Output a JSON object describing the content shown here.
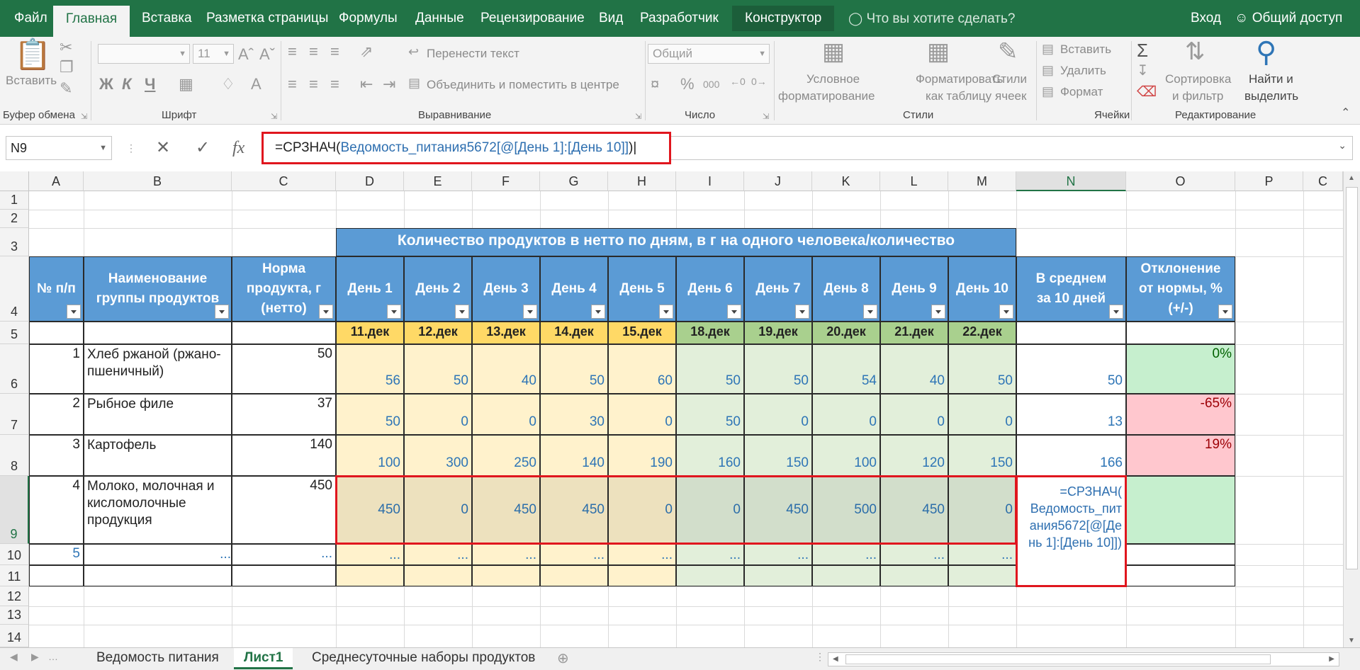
{
  "menu": {
    "tabs": [
      "Файл",
      "Главная",
      "Вставка",
      "Разметка страницы",
      "Формулы",
      "Данные",
      "Рецензирование",
      "Вид",
      "Разработчик",
      "Конструктор"
    ],
    "tell_me": "Что вы хотите сделать?",
    "sign_in": "Вход",
    "share": "Общий доступ"
  },
  "ribbon": {
    "paste": "Вставить",
    "clipboard_group": "Буфер обмена",
    "font_group": "Шрифт",
    "font_size": "11",
    "bold": "Ж",
    "italic": "К",
    "underline": "Ч",
    "wrap_text": "Перенести текст",
    "merge_center": "Объединить и поместить в центре",
    "alignment_group": "Выравнивание",
    "number_format": "Общий",
    "number_group": "Число",
    "conditional_l1": "Условное",
    "conditional_l2": "форматирование",
    "format_table_l1": "Форматировать",
    "format_table_l2": "как таблицу",
    "cell_styles_l1": "Стили",
    "cell_styles_l2": "ячеек",
    "styles_group": "Стили",
    "insert": "Вставить",
    "delete": "Удалить",
    "format": "Формат",
    "cells_group": "Ячейки",
    "sort_l1": "Сортировка",
    "sort_l2": "и фильтр",
    "find_l1": "Найти и",
    "find_l2": "выделить",
    "editing_group": "Редактирование"
  },
  "formula_bar": {
    "name_box": "N9",
    "formula_prefix": "=СРЗНАЧ(",
    "formula_ref": "Ведомость_питания5672[@[День 1]:[День 10]]",
    "formula_suffix": ")"
  },
  "columns": [
    "A",
    "B",
    "C",
    "D",
    "E",
    "F",
    "G",
    "H",
    "I",
    "J",
    "K",
    "L",
    "M",
    "N",
    "O",
    "P",
    "C"
  ],
  "rows": [
    "1",
    "2",
    "3",
    "4",
    "5",
    "6",
    "7",
    "8",
    "9",
    "10",
    "11",
    "12",
    "13",
    "14"
  ],
  "table": {
    "banner": "Количество продуктов в нетто по дням, в г на одного человека/количество",
    "headers": {
      "num": "№ п/п",
      "name_l1": "Наименование",
      "name_l2": "группы продуктов",
      "norm_l1": "Норма",
      "norm_l2": "продукта, г",
      "norm_l3": "(нетто)",
      "days": [
        "День 1",
        "День 2",
        "День 3",
        "День 4",
        "День 5",
        "День 6",
        "День 7",
        "День 8",
        "День 9",
        "День 10"
      ],
      "avg_l1": "В среднем",
      "avg_l2": "за 10 дней",
      "dev_l1": "Отклонение",
      "dev_l2": "от нормы, %",
      "dev_l3": "(+/-)"
    },
    "dates": [
      "11.дек",
      "12.дек",
      "13.дек",
      "14.дек",
      "15.дек",
      "18.дек",
      "19.дек",
      "20.дек",
      "21.дек",
      "22.дек"
    ],
    "rows": [
      {
        "n": "1",
        "name_l1": "Хлеб ржаной (ржано-",
        "name_l2": "пшеничный)",
        "name_l3": "",
        "norm": "50",
        "days": [
          "56",
          "50",
          "40",
          "50",
          "60",
          "50",
          "50",
          "54",
          "40",
          "50"
        ],
        "avg": "50",
        "dev": "0%"
      },
      {
        "n": "2",
        "name_l1": "Рыбное филе",
        "name_l2": "",
        "name_l3": "",
        "norm": "37",
        "days": [
          "50",
          "0",
          "0",
          "30",
          "0",
          "50",
          "0",
          "0",
          "0",
          "0"
        ],
        "avg": "13",
        "dev": "-65%"
      },
      {
        "n": "3",
        "name_l1": "Картофель",
        "name_l2": "",
        "name_l3": "",
        "norm": "140",
        "days": [
          "100",
          "300",
          "250",
          "140",
          "190",
          "160",
          "150",
          "100",
          "120",
          "150"
        ],
        "avg": "166",
        "dev": "19%"
      },
      {
        "n": "4",
        "name_l1": "Молоко, молочная и",
        "name_l2": "кисломолочные",
        "name_l3": "продукция",
        "norm": "450",
        "days": [
          "450",
          "0",
          "450",
          "450",
          "0",
          "0",
          "450",
          "500",
          "450",
          "0"
        ],
        "avg": "",
        "dev": ""
      },
      {
        "n": "5",
        "name_l1": "...",
        "name_l2": "",
        "name_l3": "",
        "norm": "...",
        "days": [
          "...",
          "...",
          "...",
          "...",
          "...",
          "...",
          "...",
          "...",
          "...",
          "..."
        ],
        "avg": "",
        "dev": ""
      }
    ],
    "edit_text": "=СРЗНАЧ( Ведомость_пит ания5672[@[Де нь 1]:[День 10]])"
  },
  "sheets": {
    "tabs": [
      "Ведомость питания",
      "Лист1",
      "Среднесуточные наборы продуктов"
    ],
    "active": "Лист1"
  },
  "colors": {
    "excel_green": "#217346",
    "header_blue": "#5b9bd5",
    "date_yellow": "#ffd966",
    "date_green": "#a9d08e",
    "highlight_red": "#e0161e"
  }
}
